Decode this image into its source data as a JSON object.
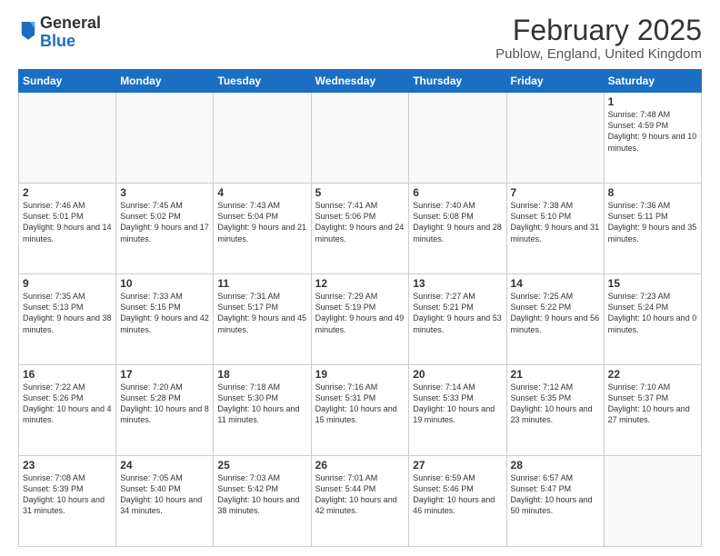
{
  "header": {
    "logo_general": "General",
    "logo_blue": "Blue",
    "month_title": "February 2025",
    "location": "Publow, England, United Kingdom"
  },
  "weekdays": [
    "Sunday",
    "Monday",
    "Tuesday",
    "Wednesday",
    "Thursday",
    "Friday",
    "Saturday"
  ],
  "weeks": [
    [
      {
        "day": "",
        "info": ""
      },
      {
        "day": "",
        "info": ""
      },
      {
        "day": "",
        "info": ""
      },
      {
        "day": "",
        "info": ""
      },
      {
        "day": "",
        "info": ""
      },
      {
        "day": "",
        "info": ""
      },
      {
        "day": "1",
        "info": "Sunrise: 7:48 AM\nSunset: 4:59 PM\nDaylight: 9 hours and 10 minutes."
      }
    ],
    [
      {
        "day": "2",
        "info": "Sunrise: 7:46 AM\nSunset: 5:01 PM\nDaylight: 9 hours and 14 minutes."
      },
      {
        "day": "3",
        "info": "Sunrise: 7:45 AM\nSunset: 5:02 PM\nDaylight: 9 hours and 17 minutes."
      },
      {
        "day": "4",
        "info": "Sunrise: 7:43 AM\nSunset: 5:04 PM\nDaylight: 9 hours and 21 minutes."
      },
      {
        "day": "5",
        "info": "Sunrise: 7:41 AM\nSunset: 5:06 PM\nDaylight: 9 hours and 24 minutes."
      },
      {
        "day": "6",
        "info": "Sunrise: 7:40 AM\nSunset: 5:08 PM\nDaylight: 9 hours and 28 minutes."
      },
      {
        "day": "7",
        "info": "Sunrise: 7:38 AM\nSunset: 5:10 PM\nDaylight: 9 hours and 31 minutes."
      },
      {
        "day": "8",
        "info": "Sunrise: 7:36 AM\nSunset: 5:11 PM\nDaylight: 9 hours and 35 minutes."
      }
    ],
    [
      {
        "day": "9",
        "info": "Sunrise: 7:35 AM\nSunset: 5:13 PM\nDaylight: 9 hours and 38 minutes."
      },
      {
        "day": "10",
        "info": "Sunrise: 7:33 AM\nSunset: 5:15 PM\nDaylight: 9 hours and 42 minutes."
      },
      {
        "day": "11",
        "info": "Sunrise: 7:31 AM\nSunset: 5:17 PM\nDaylight: 9 hours and 45 minutes."
      },
      {
        "day": "12",
        "info": "Sunrise: 7:29 AM\nSunset: 5:19 PM\nDaylight: 9 hours and 49 minutes."
      },
      {
        "day": "13",
        "info": "Sunrise: 7:27 AM\nSunset: 5:21 PM\nDaylight: 9 hours and 53 minutes."
      },
      {
        "day": "14",
        "info": "Sunrise: 7:25 AM\nSunset: 5:22 PM\nDaylight: 9 hours and 56 minutes."
      },
      {
        "day": "15",
        "info": "Sunrise: 7:23 AM\nSunset: 5:24 PM\nDaylight: 10 hours and 0 minutes."
      }
    ],
    [
      {
        "day": "16",
        "info": "Sunrise: 7:22 AM\nSunset: 5:26 PM\nDaylight: 10 hours and 4 minutes."
      },
      {
        "day": "17",
        "info": "Sunrise: 7:20 AM\nSunset: 5:28 PM\nDaylight: 10 hours and 8 minutes."
      },
      {
        "day": "18",
        "info": "Sunrise: 7:18 AM\nSunset: 5:30 PM\nDaylight: 10 hours and 11 minutes."
      },
      {
        "day": "19",
        "info": "Sunrise: 7:16 AM\nSunset: 5:31 PM\nDaylight: 10 hours and 15 minutes."
      },
      {
        "day": "20",
        "info": "Sunrise: 7:14 AM\nSunset: 5:33 PM\nDaylight: 10 hours and 19 minutes."
      },
      {
        "day": "21",
        "info": "Sunrise: 7:12 AM\nSunset: 5:35 PM\nDaylight: 10 hours and 23 minutes."
      },
      {
        "day": "22",
        "info": "Sunrise: 7:10 AM\nSunset: 5:37 PM\nDaylight: 10 hours and 27 minutes."
      }
    ],
    [
      {
        "day": "23",
        "info": "Sunrise: 7:08 AM\nSunset: 5:39 PM\nDaylight: 10 hours and 31 minutes."
      },
      {
        "day": "24",
        "info": "Sunrise: 7:05 AM\nSunset: 5:40 PM\nDaylight: 10 hours and 34 minutes."
      },
      {
        "day": "25",
        "info": "Sunrise: 7:03 AM\nSunset: 5:42 PM\nDaylight: 10 hours and 38 minutes."
      },
      {
        "day": "26",
        "info": "Sunrise: 7:01 AM\nSunset: 5:44 PM\nDaylight: 10 hours and 42 minutes."
      },
      {
        "day": "27",
        "info": "Sunrise: 6:59 AM\nSunset: 5:46 PM\nDaylight: 10 hours and 46 minutes."
      },
      {
        "day": "28",
        "info": "Sunrise: 6:57 AM\nSunset: 5:47 PM\nDaylight: 10 hours and 50 minutes."
      },
      {
        "day": "",
        "info": ""
      }
    ]
  ]
}
